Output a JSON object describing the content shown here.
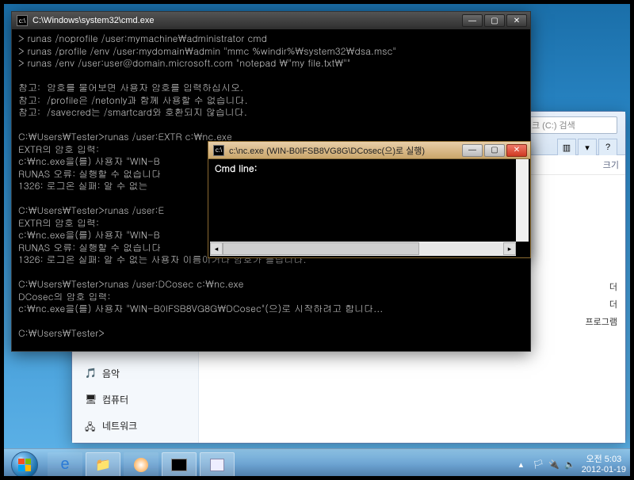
{
  "cmd": {
    "title": "C:\\Windows\\system32\\cmd.exe",
    "lines": [
      "> runas /noprofile /user:mymachine\\administrator cmd",
      "> runas /profile /env /user:mydomain\\admin \"mmc %windir%\\system32\\dsa.msc\"",
      "> runas /env /user:user@domain.microsoft.com \"notepad \\\"my file.txt\\\"\"",
      "",
      "참고:  암호를 물어보면 사용자 암호를 입력하십시오.",
      "참고:  /profile은 /netonly과 함께 사용할 수 없습니다.",
      "참고:  /savecred는 /smartcard와 호환되지 않습니다.",
      "",
      "C:\\Users\\Tester>runas /user:EXTR c:\\nc.exe",
      "EXTR의 암호 입력:",
      "c:\\nc.exe을(를) 사용자 \"WIN-B",
      "RUNAS 오류: 실행할 수 없습니다",
      "1326: 로그온 실패: 알 수 없는",
      "",
      "C:\\Users\\Tester>runas /user:E",
      "EXTR의 암호 입력:",
      "c:\\nc.exe을(를) 사용자 \"WIN-B",
      "RUNAS 오류: 실행할 수 없습니다",
      "1326: 로그온 실패: 알 수 없는 사용자 이름이거나 암호가 틀립니다.",
      "",
      "C:\\Users\\Tester>runas /user:DCosec c:\\nc.exe",
      "DCosec의 암호 입력:",
      "c:\\nc.exe을(를) 사용자 \"WIN-B0IFSB8VG8G\\DCosec\"(으)로 시작하려고 합니다...",
      "",
      "C:\\Users\\Tester>"
    ]
  },
  "nc": {
    "title": "c:\\nc.exe (WIN-B0IFSB8VG8G\\DCosec(으)로 실행)",
    "body": "Cmd line:"
  },
  "explorer": {
    "search_placeholder": "크 (C:) 검색",
    "col_size": "크기",
    "rows": [
      {
        "name": "더"
      },
      {
        "name": "더"
      },
      {
        "name": "프로그램"
      }
    ],
    "sidebar": [
      {
        "label": "음악",
        "icon": "music-icon",
        "color": "#2a7ad6"
      },
      {
        "label": "컴퓨터",
        "icon": "computer-icon",
        "color": "#6a7a8a"
      },
      {
        "label": "네트워크",
        "icon": "network-icon",
        "color": "#4a6aa0"
      }
    ],
    "view_btn": "▥"
  },
  "taskbar": {
    "items": [
      "ie",
      "explorer",
      "wmp",
      "cmd",
      "app"
    ],
    "tray": {
      "flag": "🏳",
      "power": "🔌",
      "volume": "🔈"
    },
    "clock": {
      "time": "오전 5:03",
      "date": "2012-01-19"
    }
  },
  "win_btn": {
    "min": "—",
    "max": "▢",
    "close": "✕"
  }
}
